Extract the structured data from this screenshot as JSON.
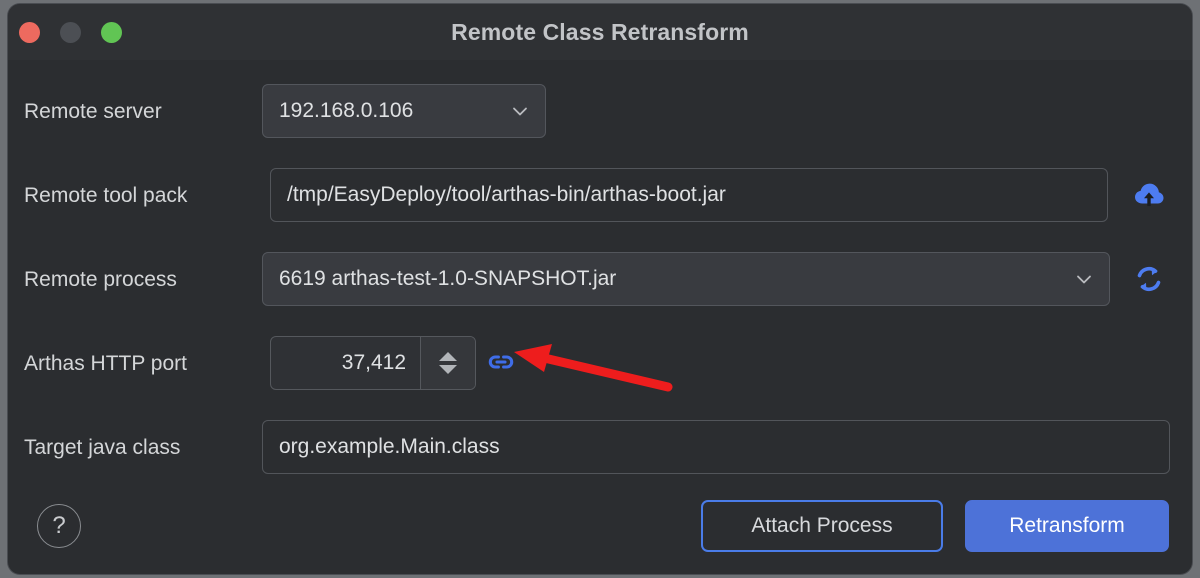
{
  "window": {
    "title": "Remote Class Retransform",
    "traffic_lights": [
      {
        "name": "close",
        "color": "#ed6a5f"
      },
      {
        "name": "minimize",
        "color": "#4c4f54"
      },
      {
        "name": "zoom",
        "color": "#61c554"
      }
    ]
  },
  "form": {
    "remote_server": {
      "label": "Remote server",
      "value": "192.168.0.106",
      "chevron_icon": "chevron-down-icon"
    },
    "remote_tool_pack": {
      "label": "Remote tool pack",
      "value": "/tmp/EasyDeploy/tool/arthas-bin/arthas-boot.jar",
      "action_icon": "cloud-upload-icon"
    },
    "remote_process": {
      "label": "Remote process",
      "value": "6619 arthas-test-1.0-SNAPSHOT.jar",
      "chevron_icon": "chevron-down-icon",
      "action_icon": "refresh-sync-icon"
    },
    "arthas_http_port": {
      "label": "Arthas HTTP port",
      "value": "37,412",
      "stepper_up_icon": "triangle-up-icon",
      "stepper_down_icon": "triangle-down-icon",
      "action_icon": "link-chain-icon"
    },
    "target_java_class": {
      "label": "Target java class",
      "value": "org.example.Main.class"
    }
  },
  "footer": {
    "help_label": "?",
    "attach_label": "Attach Process",
    "retransform_label": "Retransform"
  },
  "annotation": {
    "type": "arrow",
    "color": "#ee1d1d",
    "points_to": "link-chain-icon"
  },
  "colors": {
    "window_background": "#2b2d30",
    "titlebar": "#2f3134",
    "accent_blue": "#4d72d8",
    "icon_blue": "#4d7cf0",
    "annotation_red": "#ee1d1d",
    "text_primary": "#d4d6d8"
  }
}
